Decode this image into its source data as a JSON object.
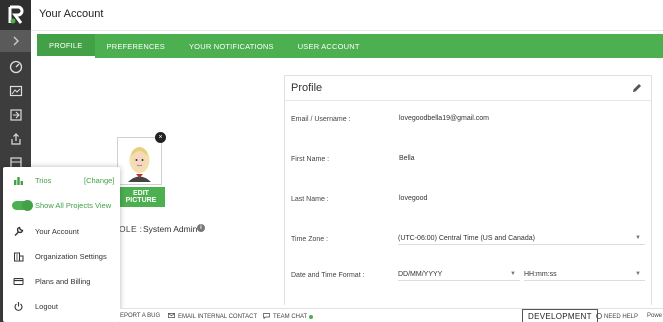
{
  "header": {
    "title": "Your Account"
  },
  "tabs": [
    {
      "label": "PROFILE"
    },
    {
      "label": "PREFERENCES"
    },
    {
      "label": "YOUR NOTIFICATIONS"
    },
    {
      "label": "USER ACCOUNT"
    }
  ],
  "avatar": {
    "edit_label": "EDIT PICTURE",
    "close_glyph": "×"
  },
  "role": {
    "label_fragment": "OLE :",
    "value": "System Admin",
    "info_glyph": "i"
  },
  "profile": {
    "title": "Profile",
    "email_label": "Email / Username :",
    "email_value": "lovegoodbella19@gmail.com",
    "first_name_label": "First Name :",
    "first_name_value": "Bella",
    "last_name_label": "Last Name :",
    "last_name_value": "lovegood",
    "timezone_label": "Time Zone :",
    "timezone_value": "(UTC-06:00) Central Time (US and Canada)",
    "datetime_label": "Date and Time Format :",
    "date_format_value": "DD/MM/YYYY",
    "time_format_value": "HH:mm:ss"
  },
  "menu": {
    "project_name": "Trios",
    "change_link": "[Change]",
    "show_all_label": "Show All Projects View",
    "show_all_enabled": true,
    "items": [
      {
        "label": "Your Account",
        "icon": "wrench-icon"
      },
      {
        "label": "Organization Settings",
        "icon": "building-icon"
      },
      {
        "label": "Plans and Billing",
        "icon": "credit-card-icon"
      },
      {
        "label": "Logout",
        "icon": "power-icon"
      }
    ]
  },
  "footer": {
    "report_bug": "EPORT A BUG",
    "email_contact": "EMAIL INTERNAL CONTACT",
    "team_chat": "TEAM CHAT",
    "environment": "DEVELOPMENT",
    "need_help": "NEED HELP",
    "powered": "Powe"
  },
  "colors": {
    "brand_green": "#4caf50",
    "rail_dark": "#3d3d3d"
  }
}
